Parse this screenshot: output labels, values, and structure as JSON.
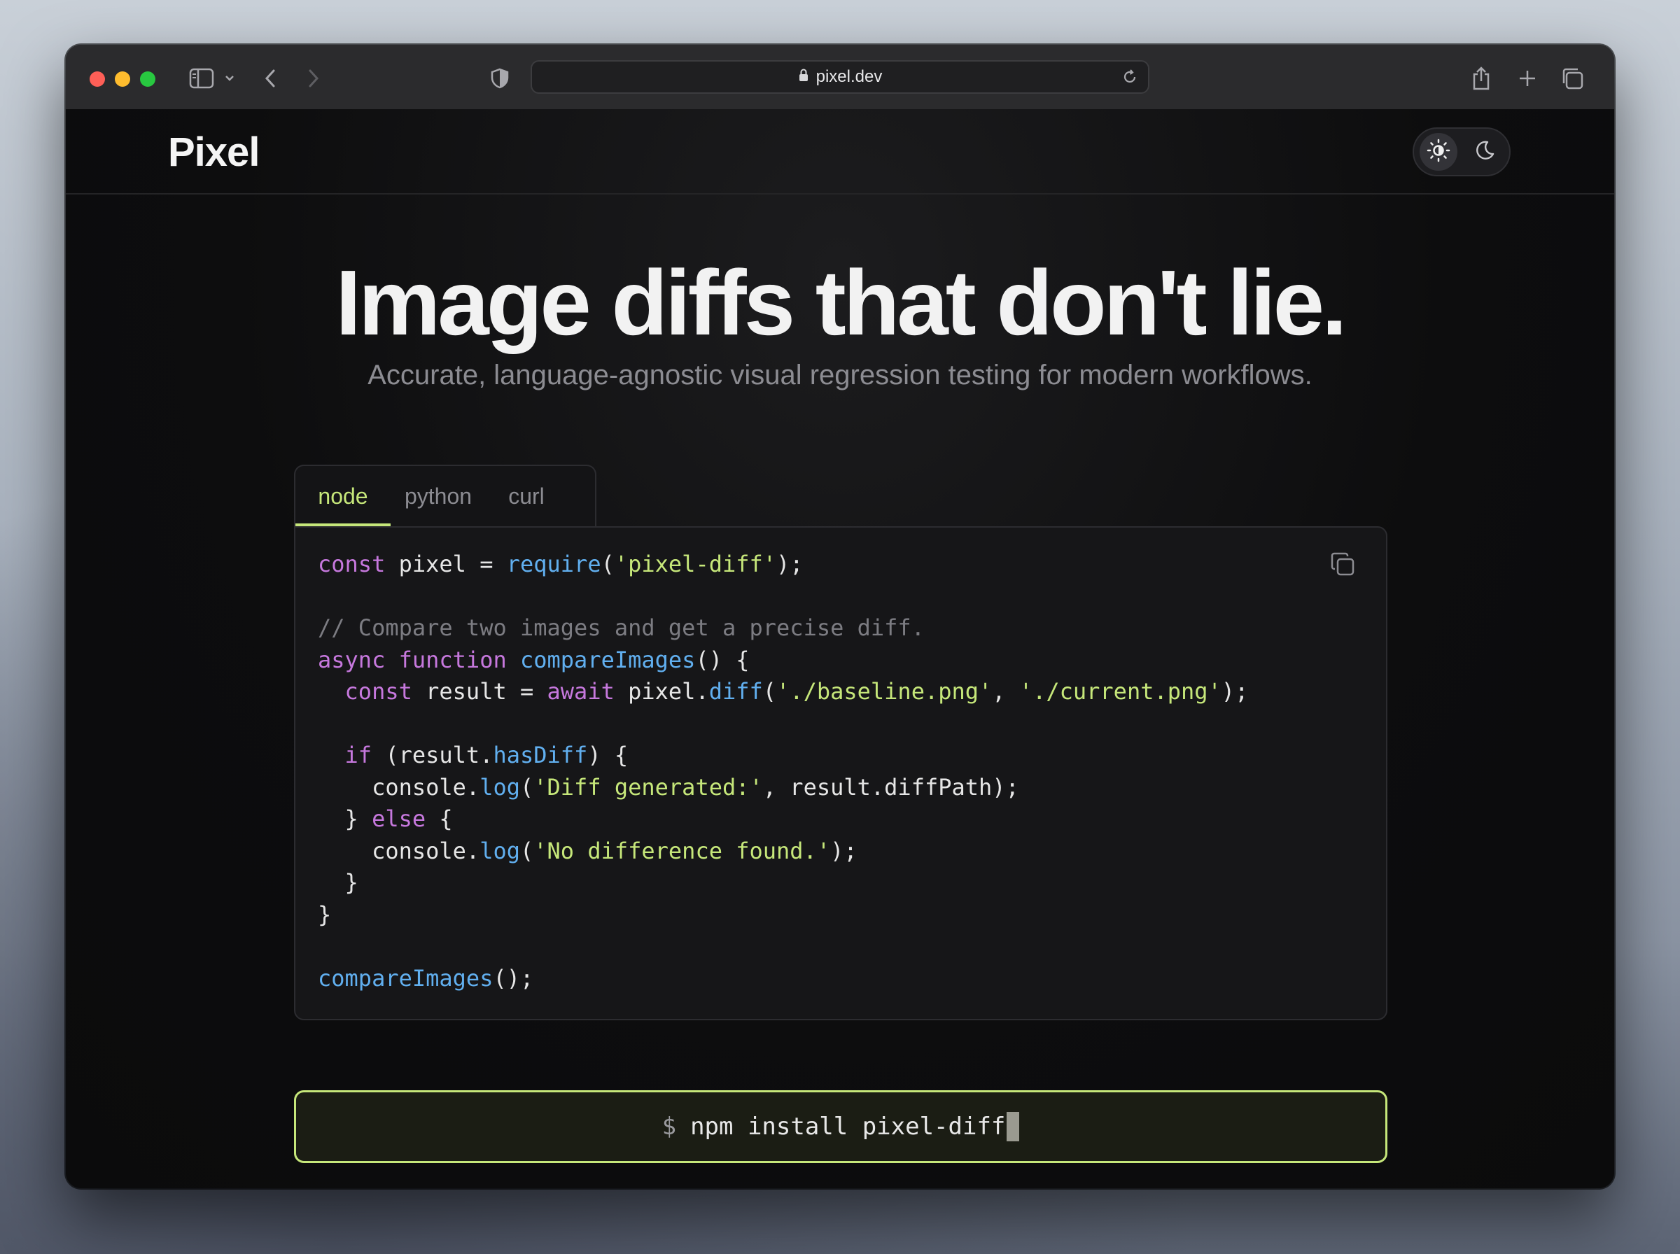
{
  "browser": {
    "url": "pixel.dev"
  },
  "header": {
    "logo": "Pixel"
  },
  "hero": {
    "title": "Image diffs that don't lie.",
    "subtitle": "Accurate, language-agnostic visual regression testing for modern workflows."
  },
  "tabs": [
    {
      "label": "node",
      "active": true
    },
    {
      "label": "python",
      "active": false
    },
    {
      "label": "curl",
      "active": false
    }
  ],
  "code": {
    "language": "node",
    "lines": [
      "const pixel = require('pixel-diff');",
      "",
      "// Compare two images and get a precise diff.",
      "async function compareImages() {",
      "  const result = await pixel.diff('./baseline.png', './current.png');",
      "",
      "  if (result.hasDiff) {",
      "    console.log('Diff generated:', result.diffPath);",
      "  } else {",
      "    console.log('No difference found.');",
      "  }",
      "}",
      "",
      "compareImages();"
    ]
  },
  "install": {
    "prompt": "$",
    "command": "npm install pixel-diff"
  },
  "colors": {
    "accent": "#c6e77a",
    "keyword": "#c678dd",
    "function": "#61afef",
    "string": "#c6e77a",
    "comment": "#7c7c82"
  },
  "icons": [
    "sidebar-icon",
    "chevron-down-icon",
    "back-arrow-icon",
    "forward-arrow-icon",
    "shield-icon",
    "lock-icon",
    "reload-icon",
    "share-icon",
    "plus-icon",
    "tabs-overview-icon",
    "sun-icon",
    "moon-icon",
    "copy-icon"
  ]
}
